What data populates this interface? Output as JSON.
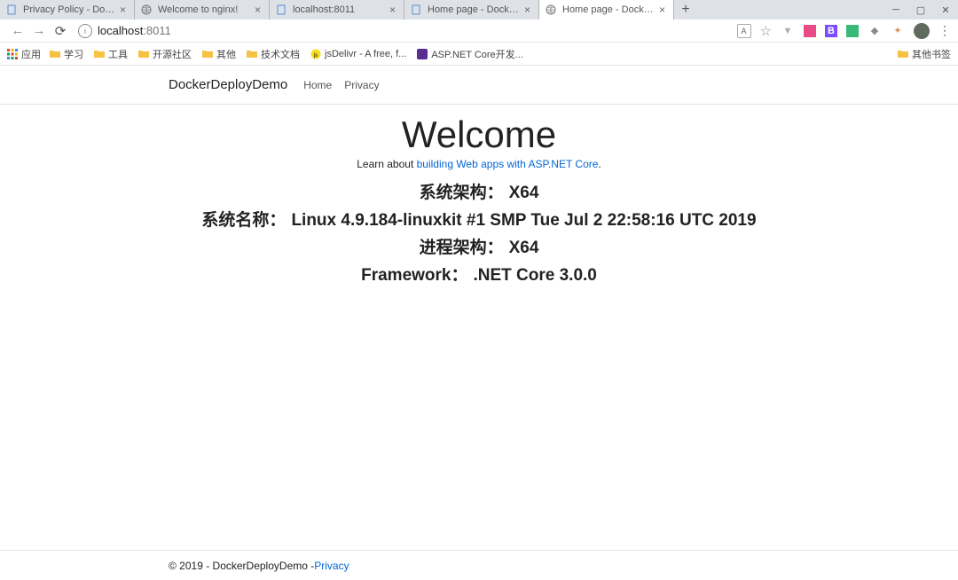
{
  "tabs": [
    {
      "title": "Privacy Policy - DockerDeploy"
    },
    {
      "title": "Welcome to nginx!"
    },
    {
      "title": "localhost:8011"
    },
    {
      "title": "Home page - DockerDeployD"
    },
    {
      "title": "Home page - DockerDeployD"
    }
  ],
  "address": {
    "host": "localhost",
    "port": ":8011"
  },
  "bookmarks": {
    "apps": "应用",
    "items": [
      "学习",
      "工具",
      "开源社区",
      "其他",
      "技术文档",
      "jsDelivr - A free, f...",
      "ASP.NET Core开发..."
    ],
    "other": "其他书签"
  },
  "nav": {
    "brand": "DockerDeployDemo",
    "home": "Home",
    "privacy": "Privacy"
  },
  "main": {
    "welcome": "Welcome",
    "learn_prefix": "Learn about ",
    "learn_link": "building Web apps with ASP.NET Core",
    "learn_suffix": ".",
    "lines": [
      {
        "label": "系统架构：",
        "value": "X64"
      },
      {
        "label": "系统名称：",
        "value": "Linux 4.9.184-linuxkit #1 SMP Tue Jul 2 22:58:16 UTC 2019"
      },
      {
        "label": "进程架构：",
        "value": "X64"
      },
      {
        "label": "Framework：",
        "value": ".NET Core 3.0.0"
      }
    ]
  },
  "footer": {
    "text": "© 2019 - DockerDeployDemo - ",
    "link": "Privacy"
  }
}
